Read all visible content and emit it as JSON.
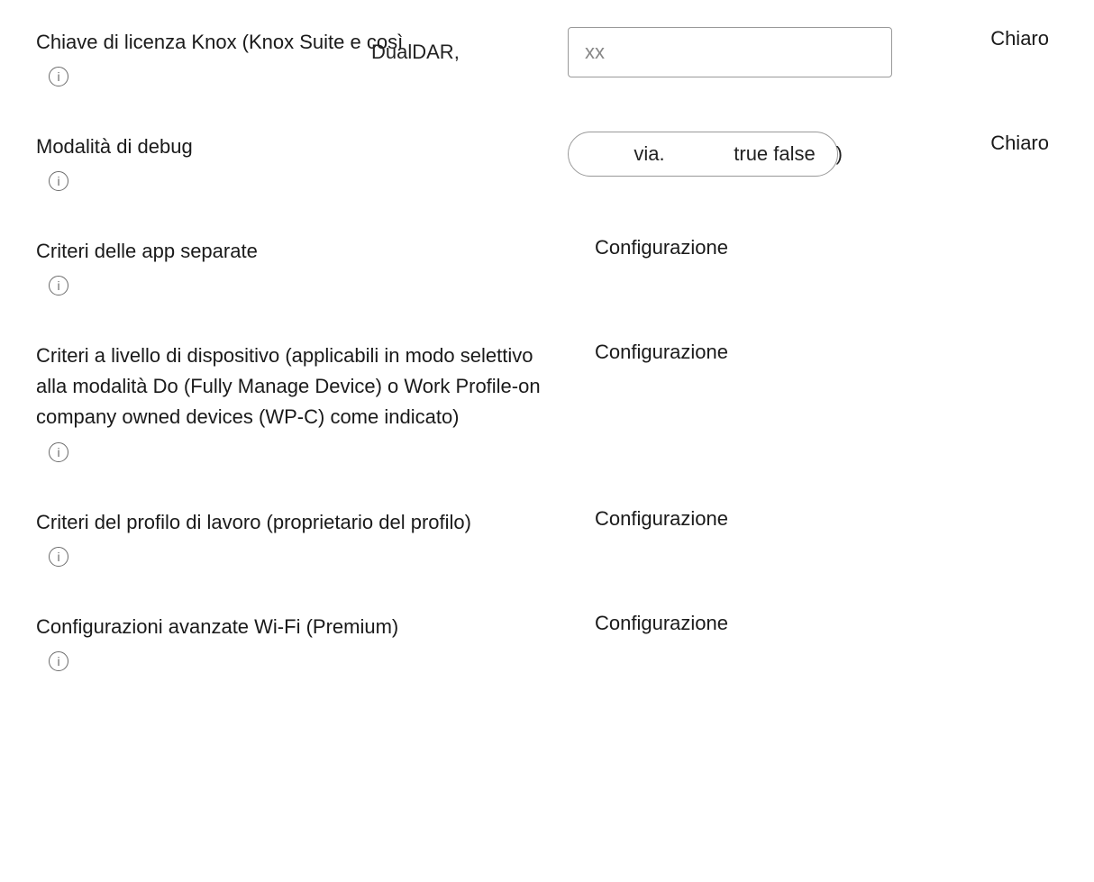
{
  "rows": {
    "knox": {
      "label": "Chiave di licenza Knox (Knox Suite e così",
      "overlay": "DualDAR,",
      "input_value": "xx",
      "action": "Chiaro"
    },
    "debug": {
      "label": "Modalità di debug",
      "seg_via": "via.",
      "seg_tf": "true false",
      "seg_paren": ")",
      "action": "Chiaro"
    },
    "sepApps": {
      "label": "Criteri delle app separate",
      "config": "Configurazione"
    },
    "deviceLevel": {
      "label": "Criteri a livello di dispositivo (applicabili in modo selettivo alla modalità Do (Fully Manage Device) o Work Profile-on company owned devices (WP-C) come indicato)",
      "config": "Configurazione"
    },
    "workProfile": {
      "label": "Criteri del profilo di lavoro (proprietario del profilo)",
      "config": "Configurazione"
    },
    "wifi": {
      "label": "Configurazioni avanzate Wi-Fi (Premium)",
      "config": "Configurazione"
    }
  },
  "icons": {
    "info_glyph": "i"
  }
}
